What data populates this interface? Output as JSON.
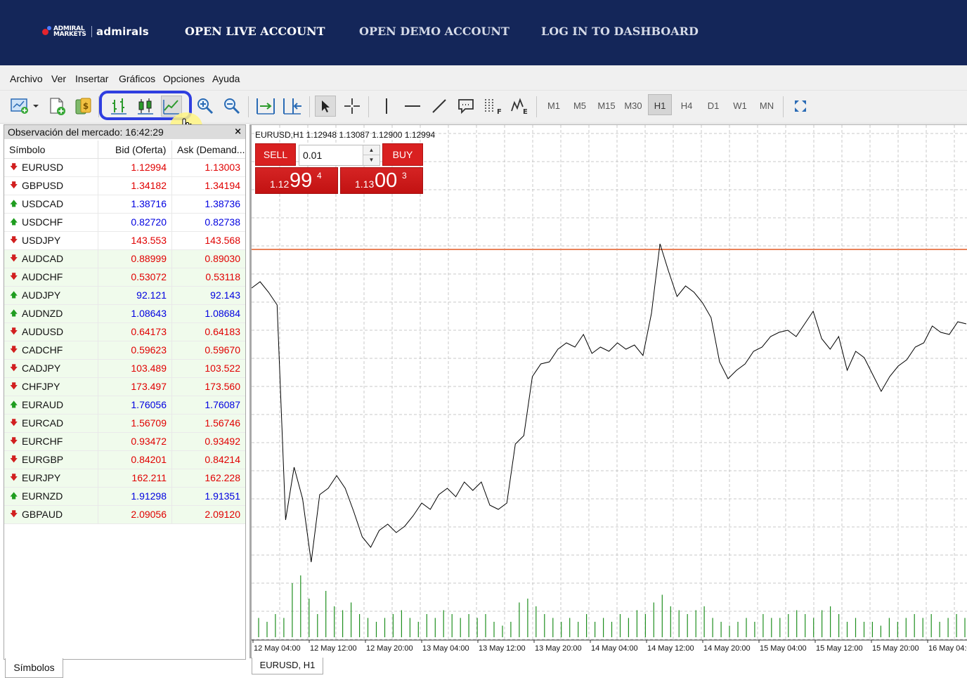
{
  "brand": {
    "logo_small": "ADMIRAL MARKETS",
    "logo_main": "admirals",
    "nav": [
      "OPEN LIVE ACCOUNT",
      "OPEN DEMO ACCOUNT",
      "LOG IN TO DASHBOARD"
    ]
  },
  "menu": [
    "Archivo",
    "Ver",
    "Insertar",
    "Gráficos",
    "Opciones",
    "Ayuda"
  ],
  "toolbar": {
    "timeframes": [
      "M1",
      "M5",
      "M15",
      "M30",
      "H1",
      "H4",
      "D1",
      "W1",
      "MN"
    ],
    "active_timeframe": "H1",
    "highlighted_group": [
      "bar-chart",
      "candlestick-chart",
      "line-chart"
    ]
  },
  "market_watch": {
    "title": "Observación del mercado: 16:42:29",
    "close": "×",
    "columns": [
      "Símbolo",
      "Bid (Oferta)",
      "Ask (Demand..."
    ],
    "rows": [
      {
        "symbol": "EURUSD",
        "dir": "down",
        "bid": "1.12994",
        "ask": "1.13003",
        "color": "red"
      },
      {
        "symbol": "GBPUSD",
        "dir": "down",
        "bid": "1.34182",
        "ask": "1.34194",
        "color": "red"
      },
      {
        "symbol": "USDCAD",
        "dir": "up",
        "bid": "1.38716",
        "ask": "1.38736",
        "color": "blue"
      },
      {
        "symbol": "USDCHF",
        "dir": "up",
        "bid": "0.82720",
        "ask": "0.82738",
        "color": "blue"
      },
      {
        "symbol": "USDJPY",
        "dir": "down",
        "bid": "143.553",
        "ask": "143.568",
        "color": "red"
      },
      {
        "symbol": "AUDCAD",
        "dir": "down",
        "bid": "0.88999",
        "ask": "0.89030",
        "color": "red"
      },
      {
        "symbol": "AUDCHF",
        "dir": "down",
        "bid": "0.53072",
        "ask": "0.53118",
        "color": "red"
      },
      {
        "symbol": "AUDJPY",
        "dir": "up",
        "bid": "92.121",
        "ask": "92.143",
        "color": "blue"
      },
      {
        "symbol": "AUDNZD",
        "dir": "up",
        "bid": "1.08643",
        "ask": "1.08684",
        "color": "blue"
      },
      {
        "symbol": "AUDUSD",
        "dir": "down",
        "bid": "0.64173",
        "ask": "0.64183",
        "color": "red"
      },
      {
        "symbol": "CADCHF",
        "dir": "down",
        "bid": "0.59623",
        "ask": "0.59670",
        "color": "red"
      },
      {
        "symbol": "CADJPY",
        "dir": "down",
        "bid": "103.489",
        "ask": "103.522",
        "color": "red"
      },
      {
        "symbol": "CHFJPY",
        "dir": "down",
        "bid": "173.497",
        "ask": "173.560",
        "color": "red"
      },
      {
        "symbol": "EURAUD",
        "dir": "up",
        "bid": "1.76056",
        "ask": "1.76087",
        "color": "blue"
      },
      {
        "symbol": "EURCAD",
        "dir": "down",
        "bid": "1.56709",
        "ask": "1.56746",
        "color": "red"
      },
      {
        "symbol": "EURCHF",
        "dir": "down",
        "bid": "0.93472",
        "ask": "0.93492",
        "color": "red"
      },
      {
        "symbol": "EURGBP",
        "dir": "down",
        "bid": "0.84201",
        "ask": "0.84214",
        "color": "red"
      },
      {
        "symbol": "EURJPY",
        "dir": "down",
        "bid": "162.211",
        "ask": "162.228",
        "color": "red"
      },
      {
        "symbol": "EURNZD",
        "dir": "up",
        "bid": "1.91298",
        "ask": "1.91351",
        "color": "blue"
      },
      {
        "symbol": "GBPAUD",
        "dir": "down",
        "bid": "2.09056",
        "ask": "2.09120",
        "color": "red"
      }
    ],
    "tab": "Símbolos"
  },
  "chart": {
    "header": "EURUSD,H1  1.12948 1.13087 1.12900 1.12994",
    "tab": "EURUSD, H1",
    "one_click": {
      "sell_label": "SELL",
      "buy_label": "BUY",
      "lot": "0.01",
      "sell_small": "1.12",
      "sell_big": "99",
      "sell_sup": "4",
      "buy_small": "1.13",
      "buy_big": "00",
      "buy_sup": "3"
    },
    "x_labels": [
      "12 May 04:00",
      "12 May 12:00",
      "12 May 20:00",
      "13 May 04:00",
      "13 May 12:00",
      "13 May 20:00",
      "14 May 04:00",
      "14 May 12:00",
      "14 May 20:00",
      "15 May 04:00",
      "15 May 12:00",
      "15 May 20:00",
      "16 May 04:00"
    ]
  },
  "chart_data": {
    "type": "line",
    "series": [
      {
        "values": [
          0.6,
          0.66,
          0.56,
          0.44,
          -1.6,
          -1.1,
          -1.4,
          -2.0,
          -1.36,
          -1.3,
          -1.18,
          -1.3,
          -1.52,
          -1.76,
          -1.86,
          -1.7,
          -1.64,
          -1.72,
          -1.66,
          -1.56,
          -1.44,
          -1.5,
          -1.36,
          -1.3,
          -1.38,
          -1.24,
          -1.32,
          -1.24,
          -1.46,
          -1.5,
          -1.44,
          -0.88,
          -0.8,
          -0.24,
          -0.12,
          -0.1,
          0.02,
          0.08,
          0.04,
          0.16,
          -0.02,
          0.04,
          0.0,
          0.08,
          0.02,
          0.06,
          -0.04,
          0.36,
          1.02,
          0.76,
          0.52,
          0.62,
          0.56,
          0.46,
          0.32,
          -0.1,
          -0.26,
          -0.18,
          -0.12,
          0.0,
          0.04,
          0.14,
          0.18,
          0.2,
          0.14,
          0.26,
          0.38,
          0.12,
          0.02,
          0.14,
          -0.18,
          0.0,
          -0.06,
          -0.22,
          -0.38,
          -0.24,
          -0.14,
          -0.08,
          0.04,
          0.08,
          0.24,
          0.18,
          0.16,
          0.28,
          0.26
        ]
      }
    ],
    "volume": [
      5,
      4,
      6,
      5,
      14,
      16,
      10,
      6,
      12,
      8,
      7,
      9,
      6,
      5,
      4,
      5,
      6,
      7,
      5,
      4,
      6,
      5,
      7,
      6,
      5,
      6,
      5,
      6,
      4,
      3,
      4,
      9,
      10,
      8,
      6,
      5,
      4,
      5,
      4,
      6,
      4,
      5,
      4,
      6,
      5,
      7,
      6,
      9,
      11,
      8,
      7,
      6,
      7,
      8,
      5,
      4,
      3,
      4,
      5,
      4,
      6,
      5,
      5,
      6,
      7,
      6,
      5,
      7,
      8,
      6,
      4,
      5,
      4,
      4,
      3,
      5,
      4,
      5,
      6,
      5,
      6,
      4,
      5,
      6,
      5
    ],
    "x_labels": [
      "12 May 04:00",
      "12 May 12:00",
      "12 May 20:00",
      "13 May 04:00",
      "13 May 12:00",
      "13 May 20:00",
      "14 May 04:00",
      "14 May 12:00",
      "14 May 20:00",
      "15 May 04:00",
      "15 May 12:00",
      "15 May 20:00",
      "16 May 04:00"
    ],
    "grid": true
  },
  "colors": {
    "brand_bg": "#142659",
    "sell": "#d92020",
    "buy": "#d92020",
    "bid_line": "#e9825a",
    "volume": "#1f8f1f",
    "highlight": "#2f3ee0"
  }
}
